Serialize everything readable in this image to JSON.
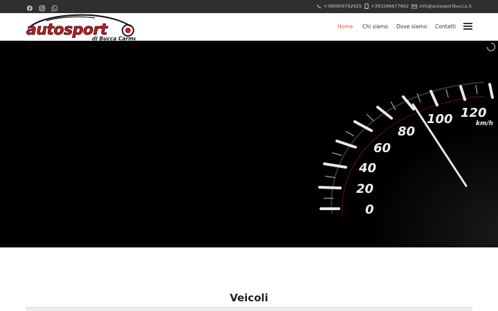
{
  "topbar": {
    "social_icons": [
      "facebook-icon",
      "instagram-icon",
      "whatsapp-icon"
    ],
    "phone1": "+390909762925",
    "phone2": "+393286677662",
    "email": "info@autosportbucca.it"
  },
  "logo": {
    "brand": "autosport",
    "tagline": "di Bucca Carmelo"
  },
  "nav": {
    "items": [
      "Home",
      "Chi siamo",
      "Dove siamo",
      "Contatti"
    ],
    "active": "Home"
  },
  "hero": {
    "speedometer_labels": [
      "0",
      "20",
      "40",
      "60",
      "80",
      "100",
      "120"
    ],
    "unit": "km/h"
  },
  "section": {
    "title": "Veicoli"
  },
  "colors": {
    "accent": "#e2532f",
    "topbar": "#2f2f2f",
    "logo_red": "#d4141c"
  }
}
